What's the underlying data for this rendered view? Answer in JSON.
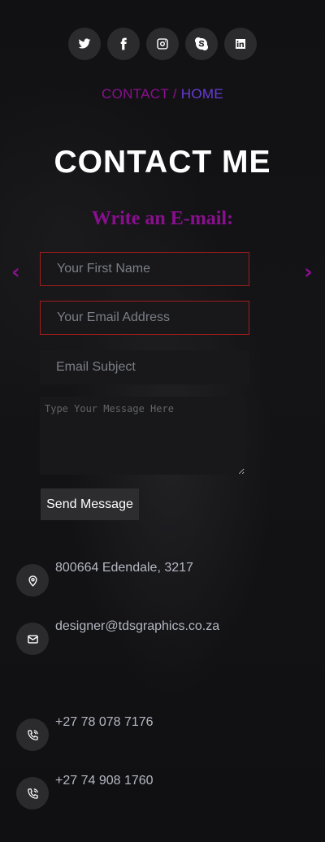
{
  "social": [
    {
      "name": "twitter-icon",
      "label": "Twitter"
    },
    {
      "name": "facebook-icon",
      "label": "Facebook"
    },
    {
      "name": "instagram-icon",
      "label": "Instagram"
    },
    {
      "name": "skype-icon",
      "label": "Skype"
    },
    {
      "name": "linkedin-icon",
      "label": "LinkedIn"
    }
  ],
  "breadcrumb": {
    "contact": "CONTACT",
    "separator": " / ",
    "home": "HOME"
  },
  "page": {
    "title": "CONTACT ME",
    "subtitle": "Write an E-mail:"
  },
  "nav": {
    "prev": "‹",
    "next": "›"
  },
  "form": {
    "first_name_placeholder": "Your First Name",
    "email_placeholder": "Your Email Address",
    "subject_placeholder": "Email Subject",
    "message_placeholder": "Type Your Message Here",
    "send_label": "Send Message"
  },
  "contact": {
    "address": "800664 Edendale, 3217",
    "email": "designer@tdsgraphics.co.za",
    "phone_1": "+27 78 078 7176",
    "phone_2": "+27 74 908 1760"
  },
  "colors": {
    "accent_purple": "#8a0f8f",
    "home_link": "#6a3ad8",
    "error_border": "#a01c1c",
    "background": "#0e0e10",
    "info_text": "#b5b8c2"
  }
}
